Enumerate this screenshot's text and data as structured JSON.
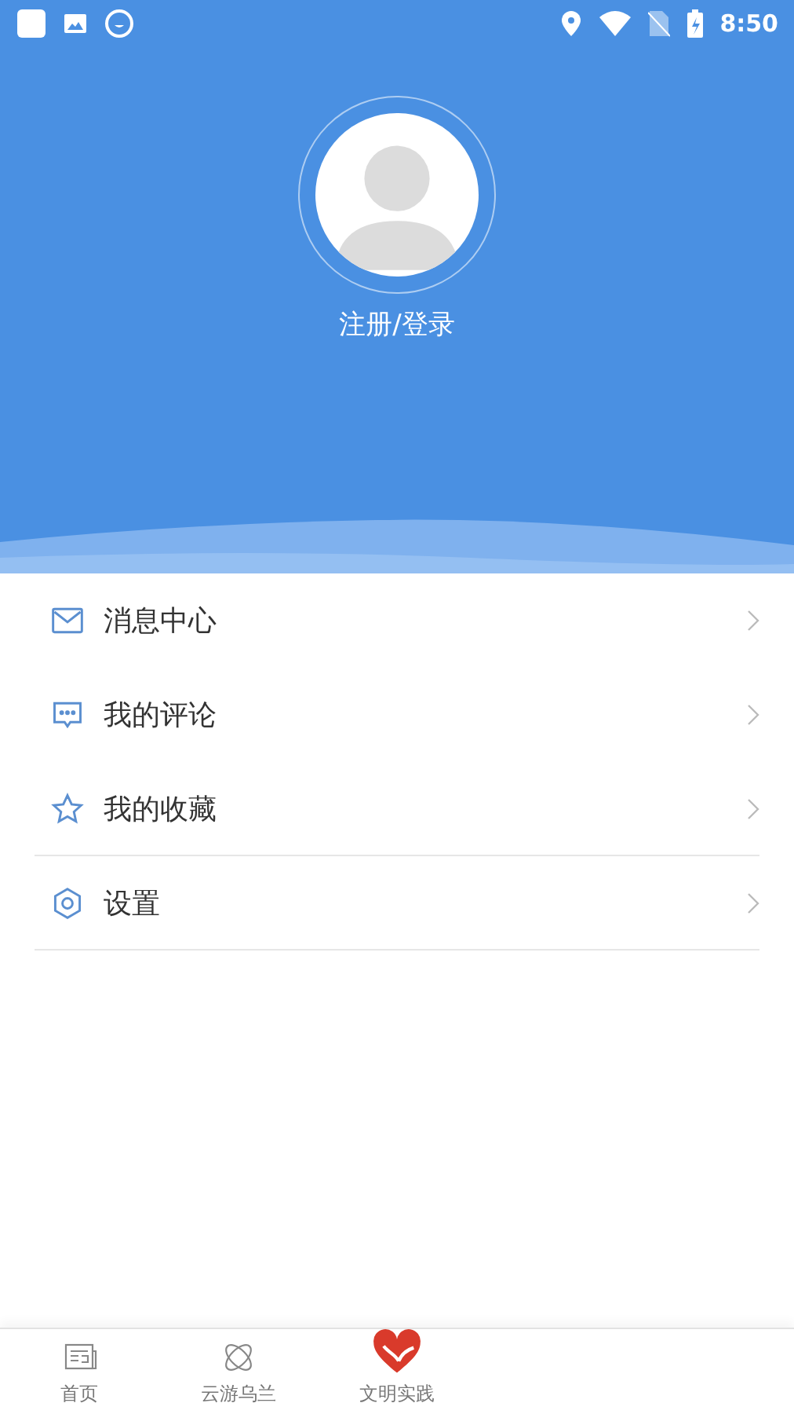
{
  "status_bar": {
    "time": "8:50"
  },
  "profile": {
    "login_label": "注册/登录"
  },
  "menu": [
    {
      "kind": "mail",
      "label": "消息中心",
      "divider_below": false
    },
    {
      "kind": "comment",
      "label": "我的评论",
      "divider_below": false
    },
    {
      "kind": "star",
      "label": "我的收藏",
      "divider_below": true
    },
    {
      "kind": "settings",
      "label": "设置",
      "divider_below": true
    }
  ],
  "tab_bar": [
    {
      "kind": "news",
      "label": "首页",
      "selected": false
    },
    {
      "kind": "orbit",
      "label": "云游乌兰",
      "selected": false
    },
    {
      "kind": "heart",
      "label": "文明实践",
      "selected": false
    }
  ]
}
